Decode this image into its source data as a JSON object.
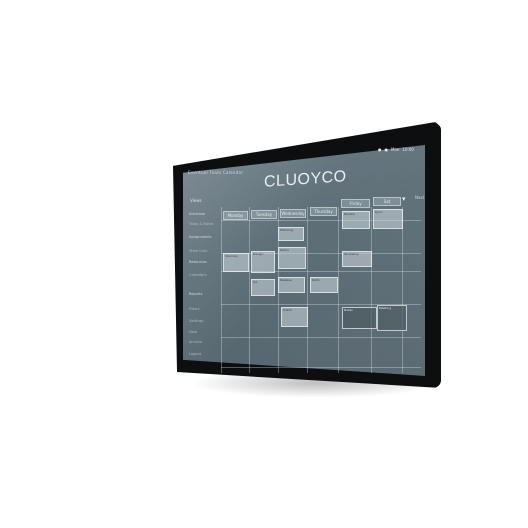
{
  "app": {
    "title": "CLUOYCO",
    "topbar_left": "Eventual Team Calendar",
    "topbar_right": [
      "●",
      "●",
      "Mon",
      "10:00"
    ],
    "sidebar_heading": "Views"
  },
  "sidebar": {
    "items": [
      "Schedule",
      "Tasks & Notes",
      "Assignments",
      "Team Lists",
      "Resources",
      "Calendars",
      "Reports",
      "Filters",
      "Settings",
      "Help",
      "Archive",
      "Logout"
    ]
  },
  "calendar": {
    "column_headers": [
      "Monday",
      "Tuesday",
      "Wednesday",
      "Thursday",
      "Friday",
      "Sat"
    ],
    "extra_header": "Next",
    "events": [
      {
        "label": "Planning"
      },
      {
        "label": "Review"
      },
      {
        "label": "Sync"
      },
      {
        "label": "Standup"
      },
      {
        "label": "Design"
      },
      {
        "label": "Demo"
      },
      {
        "label": "Workshop"
      },
      {
        "label": "QA"
      },
      {
        "label": "Release"
      },
      {
        "label": "Retro"
      },
      {
        "label": "Client"
      },
      {
        "label": "Notes"
      },
      {
        "label": "Meeting"
      }
    ]
  },
  "icons": {
    "chevron": "chevron-down-icon",
    "nav_arrow": "arrow-right-icon"
  },
  "colors": {
    "screen": "#5a6b74",
    "bezel": "#0c0e10",
    "event": "#cdd8de"
  }
}
